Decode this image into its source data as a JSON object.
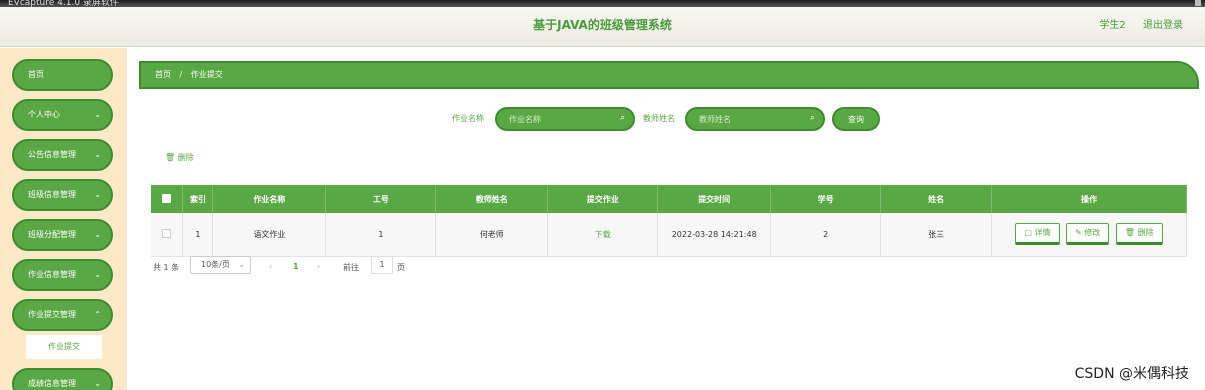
{
  "recorder": {
    "title": "EVcapture 4.1.0 录屏软件"
  },
  "header": {
    "title": "基于JAVA的班级管理系统",
    "user": "学生2",
    "logout": "退出登录"
  },
  "sidebar": {
    "items": [
      {
        "label": "首页",
        "has_chevron": false
      },
      {
        "label": "个人中心",
        "has_chevron": true
      },
      {
        "label": "公告信息管理",
        "has_chevron": true
      },
      {
        "label": "班级信息管理",
        "has_chevron": true
      },
      {
        "label": "班级分配管理",
        "has_chevron": true
      },
      {
        "label": "作业信息管理",
        "has_chevron": true
      },
      {
        "label": "作业提交管理",
        "has_chevron": true
      },
      {
        "label": "成绩信息管理",
        "has_chevron": true
      }
    ],
    "sub_item": "作业提交"
  },
  "breadcrumb": {
    "home": "首页",
    "separator": "/",
    "current": "作业提交"
  },
  "search": {
    "label1": "作业名称",
    "placeholder1": "作业名称",
    "label2": "教师姓名",
    "placeholder2": "教师姓名",
    "button": "查询"
  },
  "batch_delete": "删除",
  "table": {
    "headers": [
      "",
      "索引",
      "作业名称",
      "工号",
      "教师姓名",
      "提交作业",
      "提交时间",
      "学号",
      "姓名",
      "操作"
    ],
    "rows": [
      {
        "index": "1",
        "name": "语文作业",
        "job_no": "1",
        "teacher": "何老师",
        "submit": "下载",
        "time": "2022-03-28 14:21:48",
        "student_no": "2",
        "student": "张三"
      }
    ],
    "actions": {
      "detail": "详情",
      "edit": "修改",
      "delete": "删除"
    }
  },
  "pagination": {
    "total": "共 1 条",
    "page_size": "10条/页",
    "current_page": "1",
    "goto_label": "前往",
    "goto_value": "1",
    "goto_suffix": "页"
  },
  "watermark": "CSDN @米偶科技",
  "colors": {
    "primary": "#5aa845",
    "primary_dark": "#3c8c2e",
    "sidebar_bg": "#fde9c7"
  }
}
